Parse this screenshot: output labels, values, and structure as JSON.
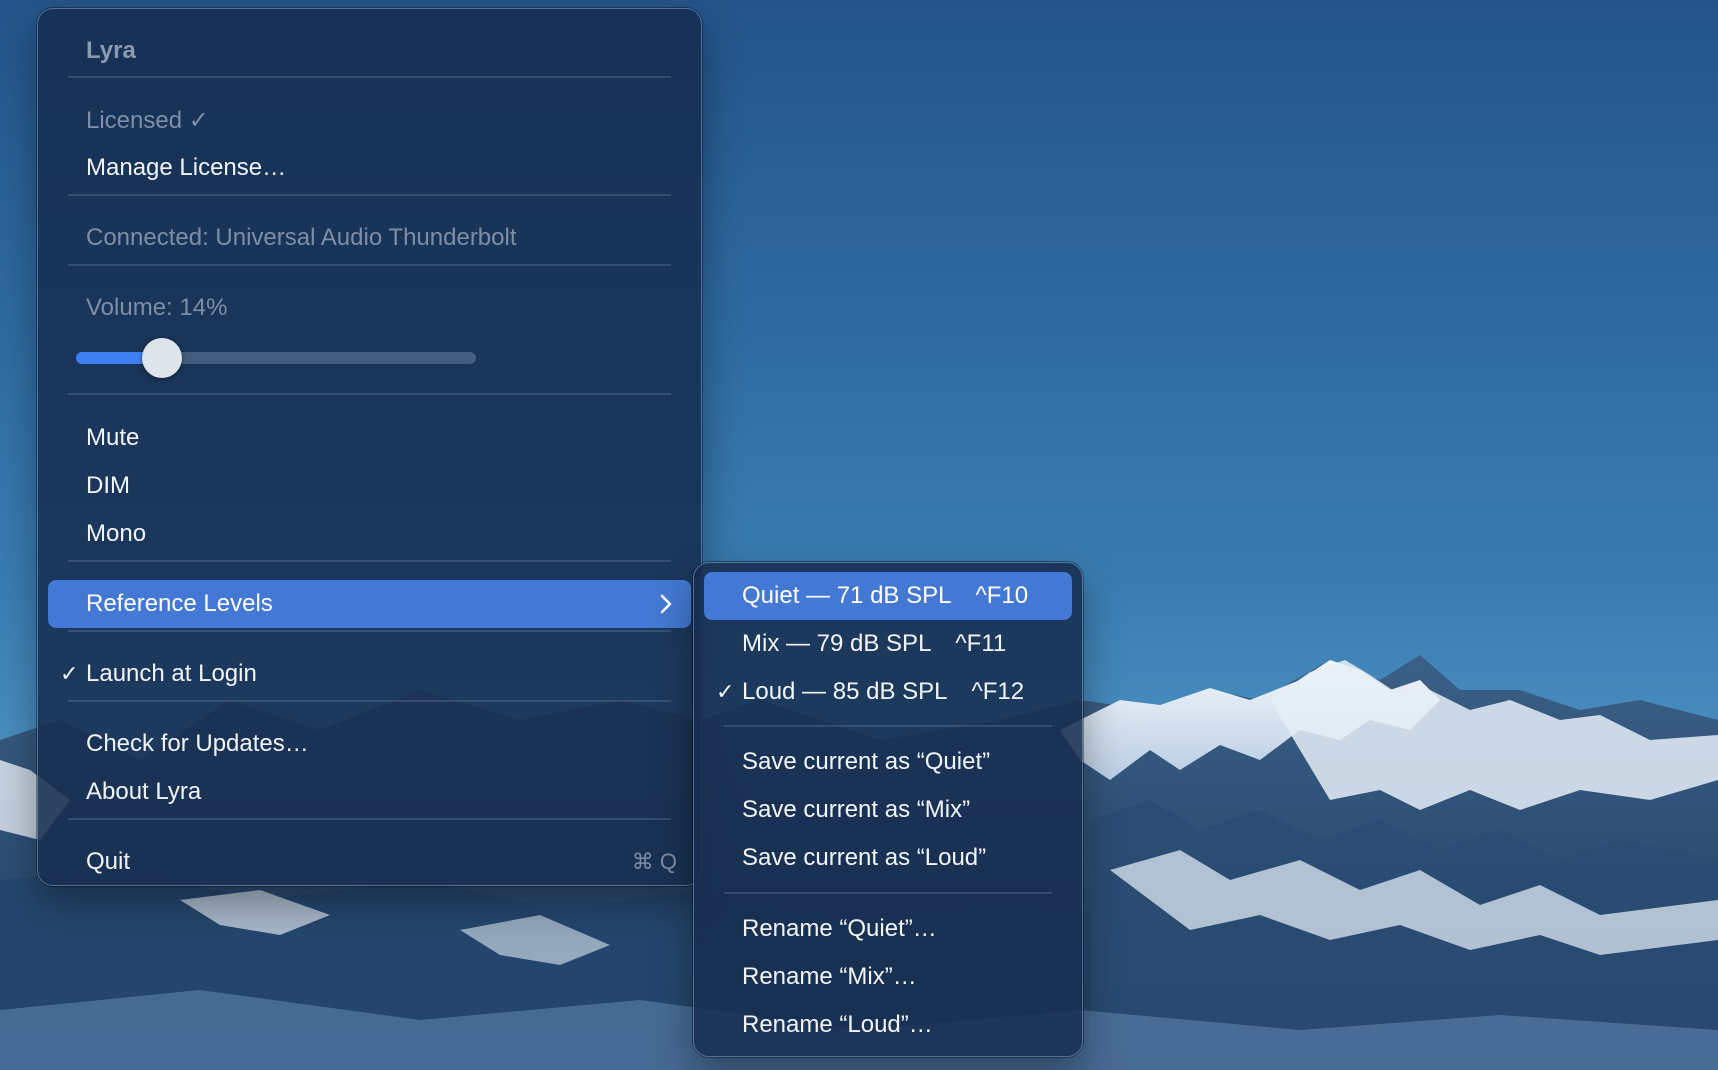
{
  "main_menu": {
    "header": "Lyra",
    "licensed": "Licensed ✓",
    "manage_license": "Manage License…",
    "connected": "Connected: Universal Audio Thunderbolt",
    "volume_label": "Volume: 14%",
    "volume_value": 0.14,
    "mute": "Mute",
    "dim": "DIM",
    "mono": "Mono",
    "reference_levels": "Reference Levels",
    "launch_at_login": "Launch at Login",
    "launch_checked": "✓",
    "check_updates": "Check for Updates…",
    "about": "About Lyra",
    "quit": "Quit",
    "quit_shortcut": "⌘ Q"
  },
  "sub_menu": {
    "items": [
      {
        "label": "Quiet — 71 dB SPL",
        "shortcut": "^F10",
        "checked": ""
      },
      {
        "label": "Mix — 79 dB SPL",
        "shortcut": "^F11",
        "checked": ""
      },
      {
        "label": "Loud — 85 dB SPL",
        "shortcut": "^F12",
        "checked": "✓"
      }
    ],
    "save_quiet": "Save current as “Quiet”",
    "save_mix": "Save current as “Mix”",
    "save_loud": "Save current as “Loud”",
    "rename_quiet": "Rename “Quiet”…",
    "rename_mix": "Rename “Mix”…",
    "rename_loud": "Rename “Loud”…"
  },
  "colors": {
    "highlight": "#4379d4",
    "slider_fill": "#3d7ef0",
    "menu_background": "#162c4e"
  },
  "icons": {
    "submenu_indicator": "chevron-right-icon",
    "checkmark": "checkmark-icon"
  }
}
